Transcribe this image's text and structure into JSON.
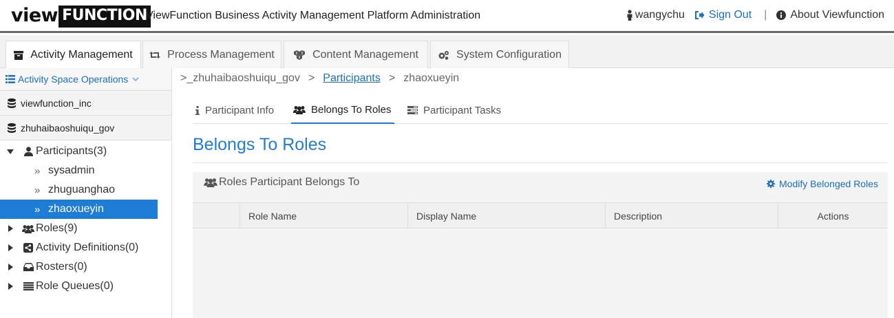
{
  "header": {
    "logo_view": "view",
    "logo_function": "FUNCTION",
    "title": "ViewFunction Business Activity Management Platform Administration",
    "user": "wangychu",
    "sign_out": "Sign Out",
    "separator": "|",
    "about": "About Viewfunction",
    "accent_color": "#1f7dd8"
  },
  "tabs": [
    {
      "label": "Activity Management",
      "icon": "archive-icon",
      "active": true
    },
    {
      "label": "Process Management",
      "icon": "retweet-icon",
      "active": false
    },
    {
      "label": "Content Management",
      "icon": "cubes-icon",
      "active": false
    },
    {
      "label": "System Configuration",
      "icon": "cogs-icon",
      "active": false
    }
  ],
  "sidebar": {
    "space_ops": "Activity Space Operations",
    "spaces": [
      "viewfunction_inc",
      "zhuhaibaoshuiqu_gov"
    ],
    "tree": {
      "participants": {
        "label": "Participants(3)",
        "children": [
          "sysadmin",
          "zhuguanghao",
          "zhaoxueyin"
        ],
        "selected": "zhaoxueyin"
      },
      "roles": "Roles(9)",
      "activity_definitions": "Activity Definitions(0)",
      "rosters": "Rosters(0)",
      "role_queues": "Role Queues(0)"
    }
  },
  "breadcrumb": {
    "prefix": ">_",
    "space": "zhuhaibaoshuiqu_gov",
    "sep": ">",
    "section": "Participants",
    "current": "zhaoxueyin"
  },
  "subtabs": [
    {
      "label": "Participant Info",
      "icon": "info-icon",
      "active": false
    },
    {
      "label": "Belongs To Roles",
      "icon": "users-icon",
      "active": true
    },
    {
      "label": "Participant Tasks",
      "icon": "tasks-icon",
      "active": false
    }
  ],
  "section_title": "Belongs To Roles",
  "panel": {
    "title": "Roles Participant Belongs To",
    "action": "Modify Belonged Roles",
    "columns": [
      "",
      "Role Name",
      "Display Name",
      "Description",
      "Actions"
    ],
    "rows": []
  }
}
